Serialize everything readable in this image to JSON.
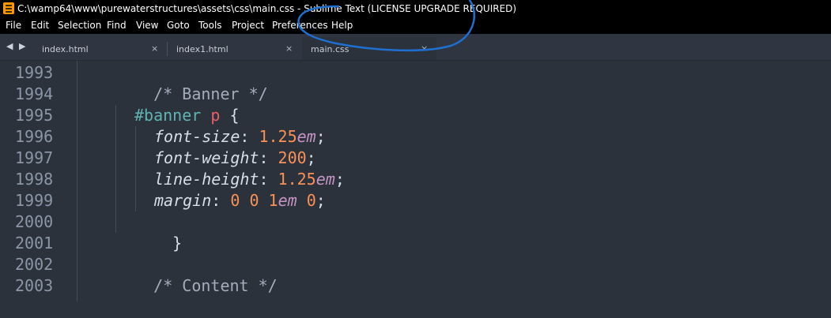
{
  "window": {
    "title": "C:\\wamp64\\www\\purewaterstructures\\assets\\css\\main.css - Sublime Text (LICENSE UPGRADE REQUIRED)"
  },
  "menu": [
    "File",
    "Edit",
    "Selection",
    "Find",
    "View",
    "Goto",
    "Tools",
    "Project",
    "Preferences",
    "Help"
  ],
  "tabs": [
    {
      "label": "index.html",
      "close": "×",
      "active": false
    },
    {
      "label": "index1.html",
      "close": "×",
      "active": false
    },
    {
      "label": "main.css",
      "close": "×",
      "active": true
    }
  ],
  "nav_arrows": "◀ ▶",
  "line_numbers": [
    "1993",
    "1994",
    "1995",
    "1996",
    "1997",
    "1998",
    "1999",
    "2000",
    "2001",
    "2002",
    "2003"
  ],
  "code": {
    "l1993": {
      "comment": "/* Banner */"
    },
    "l1995": {
      "selector": "#banner",
      "tag": "p",
      "brace": "{"
    },
    "l1996": {
      "prop": "font-size",
      "colon": ": ",
      "num": "1.25",
      "unit": "em",
      "semi": ";"
    },
    "l1997": {
      "prop": "font-weight",
      "colon": ": ",
      "num": "200",
      "semi": ";"
    },
    "l1998": {
      "prop": "line-height",
      "colon": ": ",
      "num": "1.25",
      "unit": "em",
      "semi": ";"
    },
    "l1999": {
      "prop": "margin",
      "colon": ": ",
      "n1": "0",
      "n2": "0",
      "n3": "1",
      "unit": "em",
      "n4": "0",
      "semi": ";"
    },
    "l2000": {
      "brace": "}"
    },
    "l2002": {
      "comment": "/* Content */"
    }
  },
  "colors": {
    "annotation_stroke": "#1f6fd1",
    "app_icon": "#ff9800"
  }
}
